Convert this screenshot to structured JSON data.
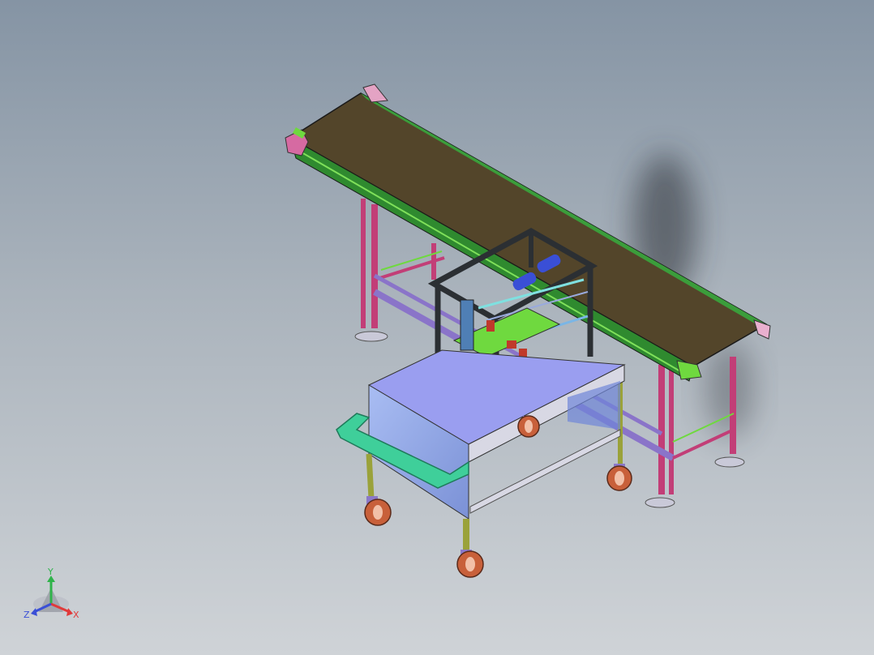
{
  "triad": {
    "y_label": "Y",
    "z_label": "Z",
    "x_label": "X",
    "colors": {
      "x": "#e03a3a",
      "y": "#2fb34a",
      "z": "#3a4fd6"
    }
  },
  "model": {
    "icon_names": [
      "conveyor-belt-icon",
      "gantry-frame-icon",
      "cart-table-icon",
      "caster-wheel-icon",
      "leveling-foot-icon"
    ],
    "colors": {
      "belt": "#53452a",
      "belt_rim": "#2f8a2f",
      "frame_pink": "#d14a8a",
      "frame_purple": "#8a74c9",
      "cart_box": "#8fa6e6",
      "cart_top": "#9a9ef0",
      "cart_leg": "#9aa23a",
      "handle": "#3fcf9a",
      "wheel": "#c8603a",
      "gantry": "#2b2f33",
      "green_part": "#6fd93f"
    }
  }
}
